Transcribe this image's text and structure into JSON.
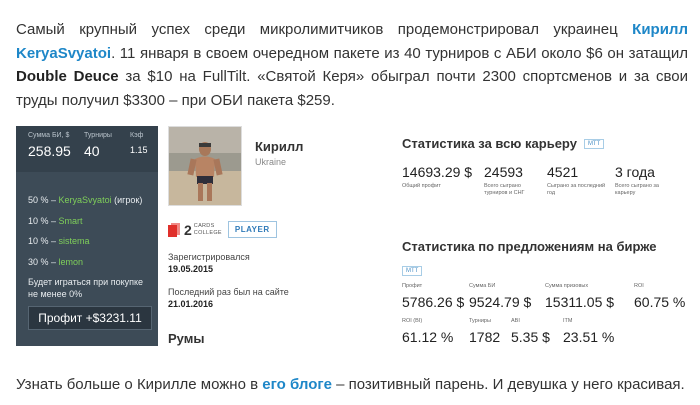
{
  "intro": {
    "before_name": "Самый крупный успех среди микролимитчиков продемонстрировал украинец ",
    "name_link": "Кирилл KeryaSvyatoi",
    "after_name": ". 11 января в своем очередном пакете из 40 турниров с АБИ около $6 он затащил ",
    "tournament": "Double Deuce",
    "after_tournament": " за $10 на FullTilt. «Святой Керя» обыграл почти 2300 спортсменов и за свои труды получил $3300 – при ОБИ пакета $259."
  },
  "panel": {
    "stats": [
      {
        "label": "Сумма БИ, $",
        "value": "258.95"
      },
      {
        "label": "Турниры",
        "value": "40"
      },
      {
        "label": "Кэф",
        "value": "1.15"
      }
    ],
    "shares": [
      {
        "percent": "50 % –",
        "name": "KeryaSvyatoi",
        "suffix": " (игрок)"
      },
      {
        "percent": "10 % –",
        "name": "Smart",
        "suffix": ""
      },
      {
        "percent": "10 % –",
        "name": "sistema",
        "suffix": ""
      },
      {
        "percent": "30 % –",
        "name": "lemon",
        "suffix": ""
      }
    ],
    "note": "Будет играться при покупке не менее 0%",
    "profit": "Профит +$3231.11"
  },
  "player": {
    "name": "Кирилл",
    "country": "Ukraine",
    "cc_number": "2",
    "cc_text_1": "CARDS",
    "cc_text_2": "COLLEGE",
    "badge": "PLAYER",
    "registered_label": "Зарегистрировался",
    "registered_value": "19.05.2015",
    "last_seen_label": "Последний раз был на сайте",
    "last_seen_value": "21.01.2016",
    "rooms_title": "Румы"
  },
  "career": {
    "title": "Статистика за всю карьеру",
    "tag": "MTT",
    "stats": [
      {
        "value": "14693.29 $",
        "label": "Общий профит"
      },
      {
        "value": "24593",
        "label": "Всего сыграно турниров и СНГ"
      },
      {
        "value": "4521",
        "label": "Сыграно за последний год"
      },
      {
        "value": "3 года",
        "label": "Всего сыграно за карьеру"
      }
    ]
  },
  "exchange": {
    "title": "Статистика по предложениям на бирже",
    "tag": "MTT",
    "row1": [
      {
        "label": "Профит",
        "value": "5786.26 $"
      },
      {
        "label": "Сумма БИ",
        "value": "9524.79 $"
      },
      {
        "label": "Сумма призовых",
        "value": "15311.05 $"
      },
      {
        "label": "ROI",
        "value": "60.75 %"
      }
    ],
    "row2": [
      {
        "label": "ROI (BI)",
        "value": "61.12 %"
      },
      {
        "label": "Турниры",
        "value": "1782"
      },
      {
        "label": "ABI",
        "value": "5.35 $"
      },
      {
        "label": "ITM",
        "value": "23.51 %"
      }
    ]
  },
  "outro": {
    "before_link": "Узнать больше о Кирилле можно в ",
    "link": "его блоге",
    "after_link": " – позитивный парень. И девушка у него красивая."
  },
  "colors": {
    "link": "#1e87c8",
    "panel_bg": "#3d4b57",
    "share_name": "#7fcf5a",
    "badge_blue": "#2f7ab8",
    "cc_red": "#e0302b"
  }
}
